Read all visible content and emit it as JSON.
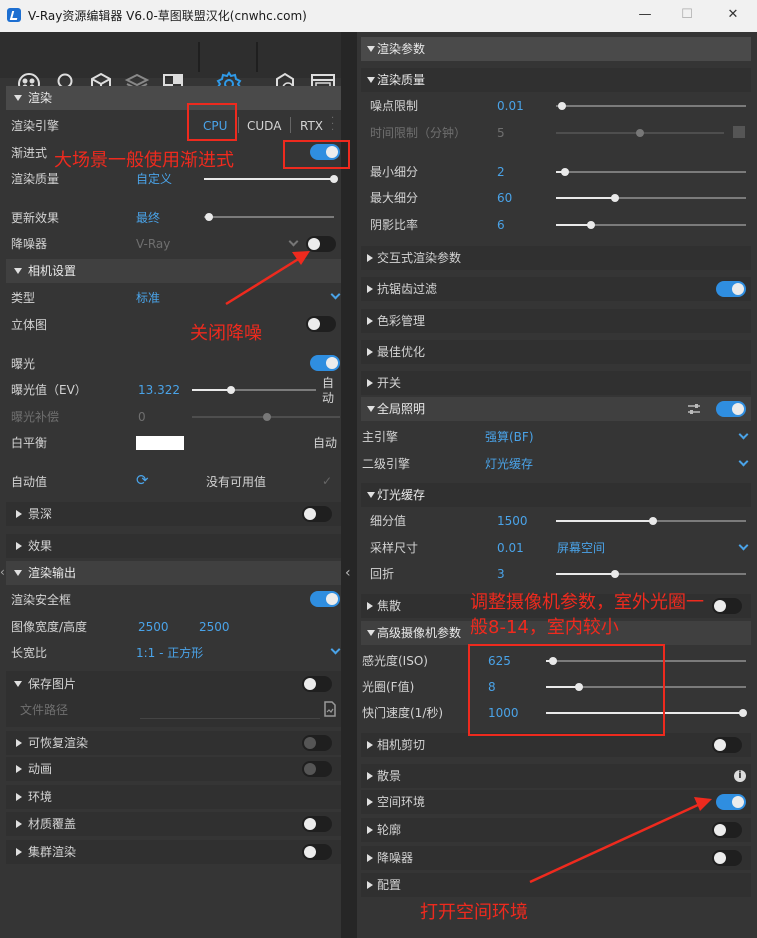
{
  "window": {
    "title": "V-Ray资源编辑器 V6.0-草图联盟汉化(cnwhc.com)",
    "min": "—",
    "max": "☐",
    "close": "✕"
  },
  "toolbar": {
    "icons": [
      "materials-icon",
      "lights-icon",
      "geometry-icon",
      "textures-icon",
      "render-elements-icon",
      "settings-icon",
      "render-icon",
      "frame-buffer-icon"
    ]
  },
  "left": {
    "render_header": "渲染",
    "engine_label": "渲染引擎",
    "engine_cpu": "CPU",
    "engine_cuda": "CUDA",
    "engine_rtx": "RTX",
    "progressive_label": "渐进式",
    "quality_label": "渲染质量",
    "quality_value": "自定义",
    "update_label": "更新效果",
    "update_value": "最终",
    "denoiser_label": "降噪器",
    "denoiser_value": "V-Ray",
    "camera_header": "相机设置",
    "type_label": "类型",
    "type_value": "标准",
    "stereo_label": "立体图",
    "exposure_label": "曝光",
    "ev_label": "曝光值（EV）",
    "ev_value": "13.322",
    "ev_auto": "自\n动",
    "comp_label": "曝光补偿",
    "comp_value": "0",
    "wb_label": "白平衡",
    "wb_auto": "自动",
    "autoval_label": "自动值",
    "autoval_value": "没有可用值",
    "dof_label": "景深",
    "effects_label": "效果",
    "output_header": "渲染输出",
    "safe_label": "渲染安全框",
    "size_label": "图像宽度/高度",
    "width": "2500",
    "height": "2500",
    "aspect_label": "长宽比",
    "aspect_value": "1:1 - 正方形",
    "save_label": "保存图片",
    "filepath_placeholder": "文件路径",
    "resumable_label": "可恢复渲染",
    "anim_label": "动画",
    "env_label": "环境",
    "override_label": "材质覆盖",
    "dr_label": "集群渲染"
  },
  "right": {
    "render_params_header": "渲染参数",
    "quality_header": "渲染质量",
    "noise_label": "噪点限制",
    "noise_value": "0.01",
    "time_label": "时间限制（分钟）",
    "time_value": "5",
    "minsub_label": "最小细分",
    "minsub_value": "2",
    "maxsub_label": "最大细分",
    "maxsub_value": "60",
    "shadow_label": "阴影比率",
    "shadow_value": "6",
    "interactive_label": "交互式渲染参数",
    "aa_label": "抗锯齿过滤",
    "color_label": "色彩管理",
    "optimize_label": "最佳优化",
    "switch_label": "开关",
    "gi_header": "全局照明",
    "primary_label": "主引擎",
    "primary_value": "强算(BF)",
    "secondary_label": "二级引擎",
    "secondary_value": "灯光缓存",
    "lc_header": "灯光缓存",
    "subdiv_label": "细分值",
    "subdiv_value": "1500",
    "sample_label": "采样尺寸",
    "sample_value": "0.01",
    "sample_mode": "屏幕空间",
    "retrace_label": "回折",
    "retrace_value": "3",
    "caustics_label": "焦散",
    "adv_cam_header": "高级摄像机参数",
    "iso_label": "感光度(ISO)",
    "iso_value": "625",
    "fstop_label": "光圈(F值)",
    "fstop_value": "8",
    "shutter_label": "快门速度(1/秒)",
    "shutter_value": "1000",
    "clip_label": "相机剪切",
    "bokeh_label": "散景",
    "aerial_label": "空间环境",
    "outline_label": "轮廓",
    "denoiser_label": "降噪器",
    "config_label": "配置"
  },
  "annotations": {
    "progressive_note": "大场景一般使用渐进式",
    "denoise_note": "关闭降噪",
    "camera_note_line1": "调整摄像机参数，室外光圈一",
    "camera_note_line2": "般8-14，室内较小",
    "aerial_note": "打开空间环境"
  },
  "colors": {
    "accent": "#2f8ee0",
    "annotation": "#ee2a1e"
  }
}
